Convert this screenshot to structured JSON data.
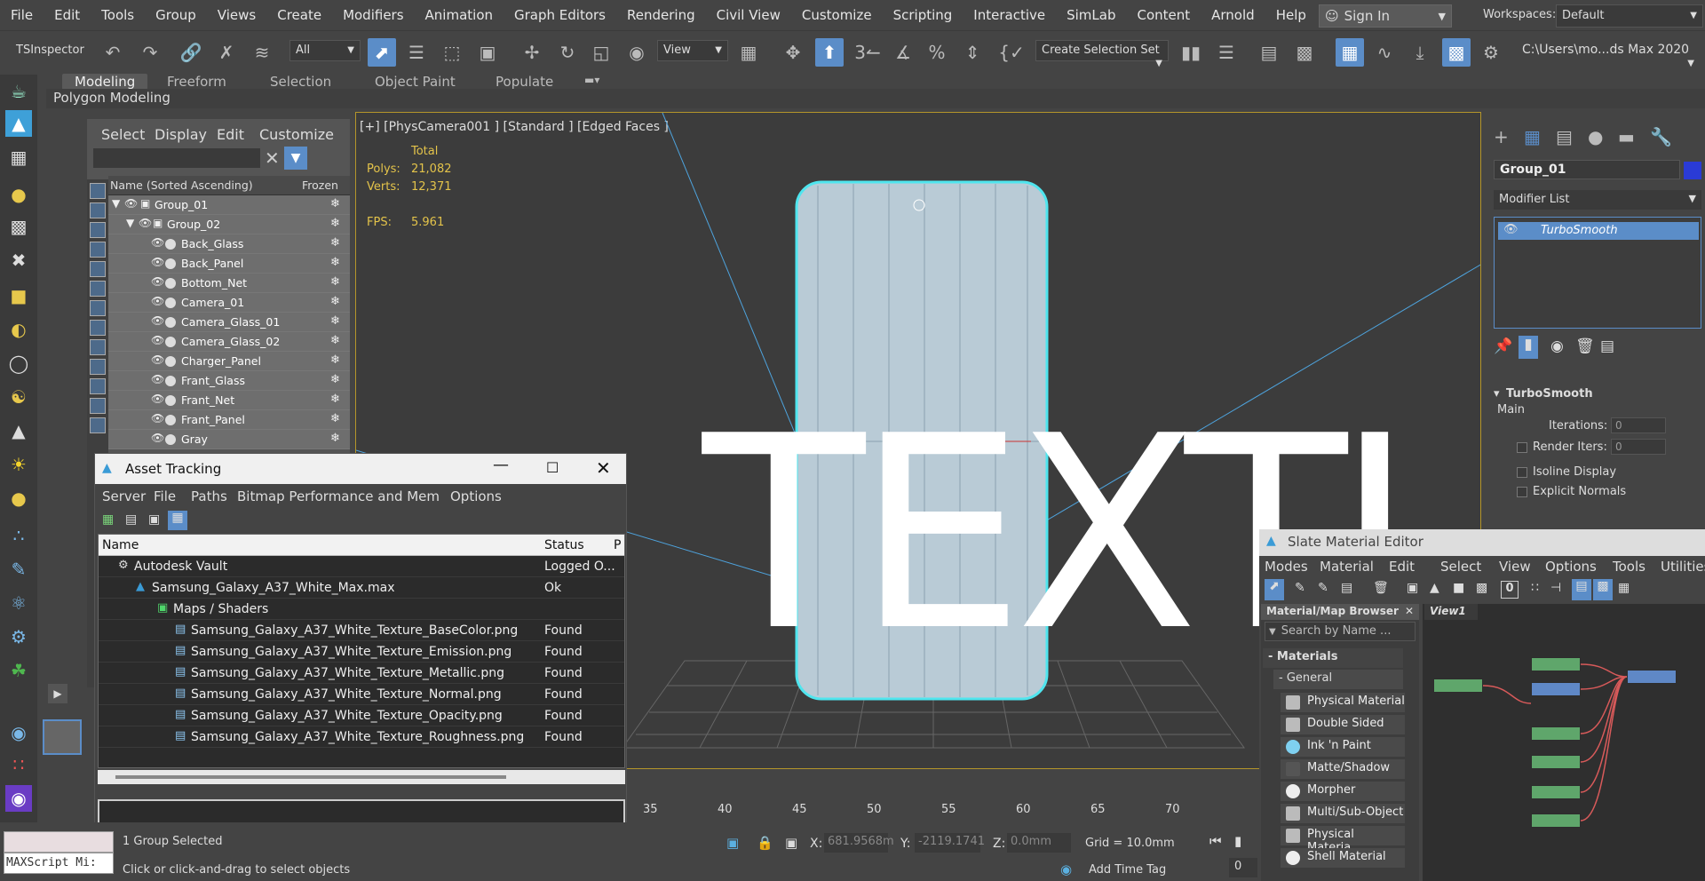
{
  "menubar": {
    "items": [
      "File",
      "Edit",
      "Tools",
      "Group",
      "Views",
      "Create",
      "Modifiers",
      "Animation",
      "Graph Editors",
      "Rendering",
      "Civil View",
      "Customize",
      "Scripting",
      "Interactive",
      "SimLab",
      "Content",
      "Arnold",
      "Help"
    ],
    "sign_in": "Sign In",
    "workspaces_label": "Workspaces:",
    "workspaces_value": "Default"
  },
  "toolbar": {
    "tsinspector": "TSInspector",
    "filter_value": "All",
    "view_value": "View",
    "selection_set": "Create Selection Set",
    "path": "C:\\Users\\mo...ds Max 2020"
  },
  "ribbon": {
    "tabs": [
      "Modeling",
      "Freeform",
      "Selection",
      "Object Paint",
      "Populate"
    ],
    "active": "Modeling",
    "sub": "Polygon Modeling"
  },
  "scene_explorer": {
    "menu": [
      "Select",
      "Display",
      "Edit",
      "Customize"
    ],
    "header_name": "Name (Sorted Ascending)",
    "header_frozen": "Frozen",
    "rows": [
      {
        "name": "Group_01",
        "level": 0
      },
      {
        "name": "Group_02",
        "level": 1
      },
      {
        "name": "Back_Glass",
        "level": 2
      },
      {
        "name": "Back_Panel",
        "level": 2
      },
      {
        "name": "Bottom_Net",
        "level": 2
      },
      {
        "name": "Camera_01",
        "level": 2
      },
      {
        "name": "Camera_Glass_01",
        "level": 2
      },
      {
        "name": "Camera_Glass_02",
        "level": 2
      },
      {
        "name": "Charger_Panel",
        "level": 2
      },
      {
        "name": "Frant_Glass",
        "level": 2
      },
      {
        "name": "Frant_Net",
        "level": 2
      },
      {
        "name": "Frant_Panel",
        "level": 2
      },
      {
        "name": "Gray",
        "level": 2
      }
    ]
  },
  "viewport": {
    "label": "[+] [PhysCamera001 ] [Standard ] [Edged Faces ]",
    "stats_total": "Total",
    "polys_label": "Polys:",
    "polys_value": "21,082",
    "verts_label": "Verts:",
    "verts_value": "12,371",
    "fps_label": "FPS:",
    "fps_value": "5.961",
    "overlay_text": "TEXTURE"
  },
  "command_panel": {
    "object_name": "Group_01",
    "object_color": "#2a3bd6",
    "modifier_list": "Modifier List",
    "modifier": "TurboSmooth",
    "rollout_title": "TurboSmooth",
    "main": "Main",
    "iterations_label": "Iterations:",
    "iterations_value": "0",
    "render_iters_label": "Render Iters:",
    "render_iters_value": "0",
    "isoline": "Isoline Display",
    "explicit_normals": "Explicit Normals"
  },
  "asset_tracking": {
    "title": "Asset Tracking",
    "menu": [
      "Server",
      "File",
      "Paths",
      "Bitmap Performance and Mem",
      "Options"
    ],
    "col_name": "Name",
    "col_status": "Status",
    "col_extra": "P",
    "rows": [
      {
        "name": "Autodesk Vault",
        "status": "Logged O...",
        "indent": 0
      },
      {
        "name": "Samsung_Galaxy_A37_White_Max.max",
        "status": "Ok",
        "indent": 1
      },
      {
        "name": "Maps / Shaders",
        "status": "",
        "indent": 2
      },
      {
        "name": "Samsung_Galaxy_A37_White_Texture_BaseColor.png",
        "status": "Found",
        "indent": 3
      },
      {
        "name": "Samsung_Galaxy_A37_White_Texture_Emission.png",
        "status": "Found",
        "indent": 3
      },
      {
        "name": "Samsung_Galaxy_A37_White_Texture_Metallic.png",
        "status": "Found",
        "indent": 3
      },
      {
        "name": "Samsung_Galaxy_A37_White_Texture_Normal.png",
        "status": "Found",
        "indent": 3
      },
      {
        "name": "Samsung_Galaxy_A37_White_Texture_Opacity.png",
        "status": "Found",
        "indent": 3
      },
      {
        "name": "Samsung_Galaxy_A37_White_Texture_Roughness.png",
        "status": "Found",
        "indent": 3
      }
    ]
  },
  "timeline": {
    "ticks": [
      "35",
      "40",
      "45",
      "50",
      "55",
      "60",
      "65",
      "70"
    ]
  },
  "status": {
    "maxscript": "MAXScript Mi:",
    "selected": "1 Group Selected",
    "hint": "Click or click-and-drag to select objects",
    "x_label": "X:",
    "x_value": "681.9568m",
    "y_label": "Y:",
    "y_value": "-2119.1741",
    "z_label": "Z:",
    "z_value": "0.0mm",
    "grid": "Grid = 10.0mm",
    "add_time_tag": "Add Time Tag",
    "frame": "0"
  },
  "slate": {
    "title": "Slate Material Editor",
    "menu": [
      "Modes",
      "Material",
      "Edit",
      "Select",
      "View",
      "Options",
      "Tools",
      "Utilities"
    ],
    "browser_title": "Material/Map Browser",
    "search_placeholder": "Search by Name ...",
    "view_tab": "View1",
    "materials_header": "Materials",
    "general_header": "General",
    "items": [
      "Physical Material",
      "Double Sided",
      "Ink 'n Paint",
      "Matte/Shadow",
      "Morpher",
      "Multi/Sub-Object",
      "Physical Materia...",
      "Shell Material"
    ],
    "toolbar_num": "0"
  }
}
